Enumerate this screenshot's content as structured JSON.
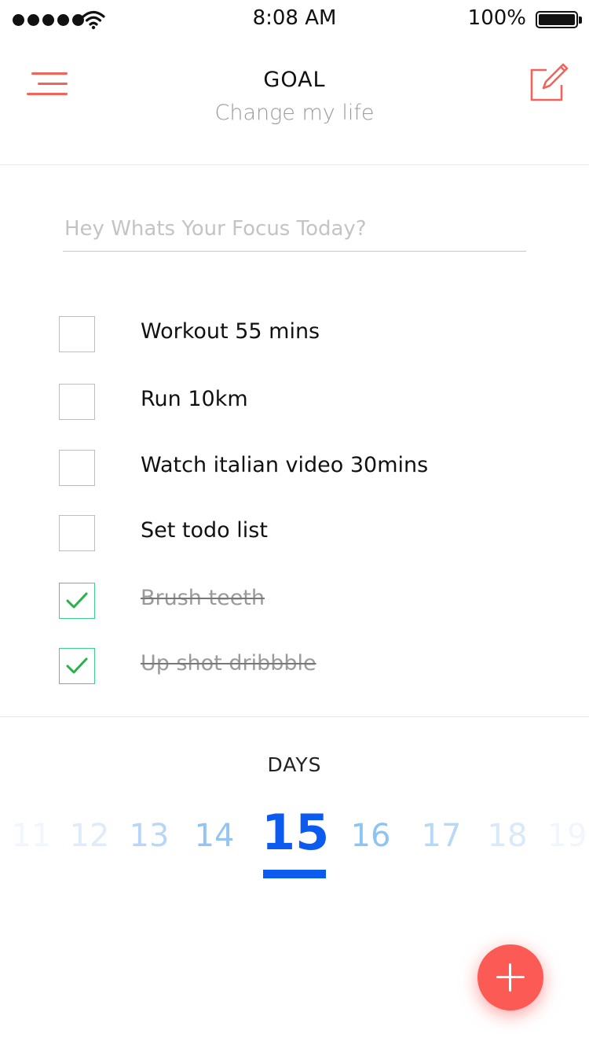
{
  "status_bar": {
    "time": "8:08 AM",
    "battery_percent": "100%",
    "signal_icon": "signal-dots-icon",
    "wifi_icon": "wifi-icon",
    "battery_icon": "battery-icon"
  },
  "header": {
    "title": "GOAL",
    "subtitle": "Change my life",
    "menu_icon": "menu-icon",
    "edit_icon": "edit-note-icon"
  },
  "focus": {
    "placeholder": "Hey Whats Your Focus Today?",
    "value": ""
  },
  "tasks": [
    {
      "label": "Workout 55 mins",
      "done": false
    },
    {
      "label": "Run 10km",
      "done": false
    },
    {
      "label": "Watch italian video 30mins",
      "done": false
    },
    {
      "label": "Set todo list",
      "done": false
    },
    {
      "label": "Brush teeth",
      "done": true
    },
    {
      "label": "Up shot dribbble",
      "done": true
    }
  ],
  "days": {
    "label": "DAYS",
    "items": [
      "11",
      "12",
      "13",
      "14",
      "15",
      "16",
      "17",
      "18",
      "19"
    ],
    "selected": "15"
  },
  "fab": {
    "icon": "plus-icon"
  },
  "colors": {
    "accent": "#f0645c",
    "fab": "#fb5a55",
    "selected_day": "#0c5bf0",
    "check": "#27b24a",
    "check_border": "#3ccf8e",
    "muted_text": "#9a9a9a"
  }
}
